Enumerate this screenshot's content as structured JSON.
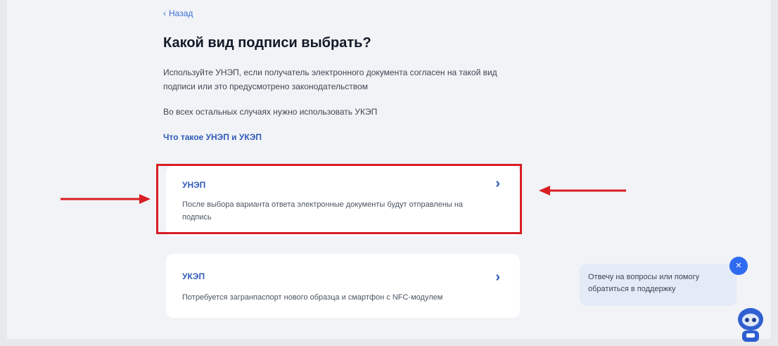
{
  "back": {
    "label": "Назад",
    "chevron": "‹"
  },
  "page": {
    "title": "Какой вид подписи выбрать?",
    "description": "Используйте УНЭП, если получатель электронного документа согласен на такой вид подписи или это предусмотрено законодательством",
    "description2": "Во всех остальных случаях нужно использовать УКЭП",
    "link": "Что такое УНЭП и УКЭП"
  },
  "options": [
    {
      "title": "УНЭП",
      "text": "После выбора варианта ответа электронные документы будут отправлены на подпись",
      "chevron": "›"
    },
    {
      "title": "УКЭП",
      "text": "Потребуется загранпаспорт нового образца и смартфон с NFC-модулем",
      "chevron": "›"
    }
  ],
  "chat": {
    "text": "Отвечу на вопросы или помогу обратиться в поддержку",
    "close": "×"
  },
  "colors": {
    "accent": "#2f5bb8",
    "highlight": "#d81e24",
    "background": "#f1f3f6",
    "chat_bg": "#e3ebf7"
  }
}
